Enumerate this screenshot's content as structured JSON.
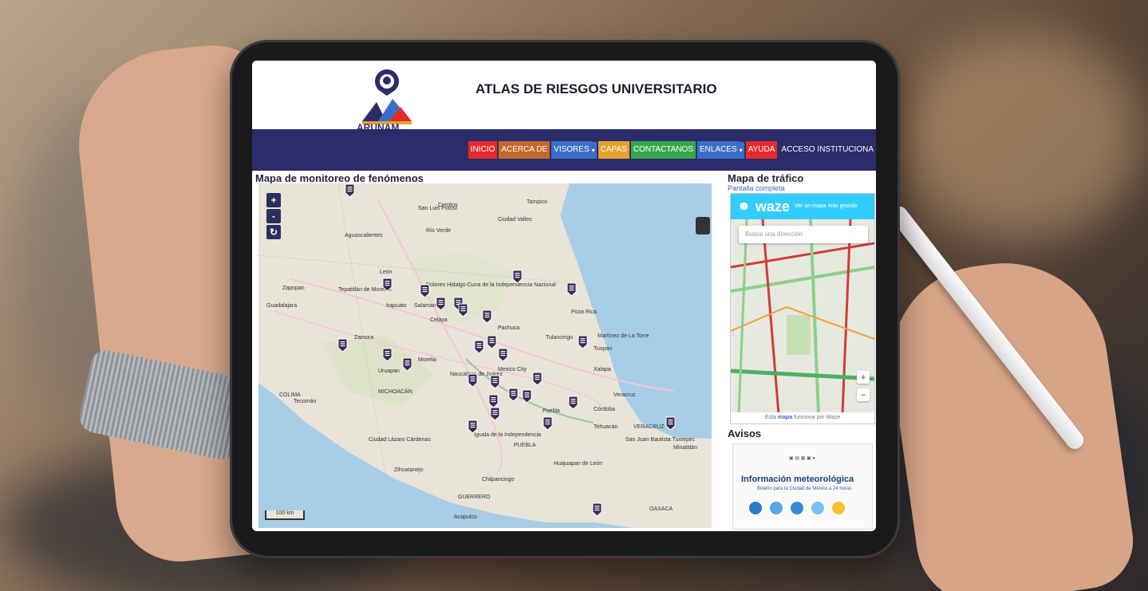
{
  "header": {
    "logo_text": "ARUNAM",
    "title": "ATLAS DE RIESGOS UNIVERSITARIO"
  },
  "nav": {
    "items": [
      {
        "label": "INICIO",
        "color": "#e52b2b"
      },
      {
        "label": "ACERCA DE",
        "color": "#c4692c"
      },
      {
        "label": "VISORES",
        "color": "#3a6fc9",
        "dropdown": true
      },
      {
        "label": "CAPAS",
        "color": "#e5a12b"
      },
      {
        "label": "CONTACTANOS",
        "color": "#36a94b"
      },
      {
        "label": "ENLACES",
        "color": "#3a6fc9",
        "dropdown": true
      },
      {
        "label": "AYUDA",
        "color": "#e52b2b"
      },
      {
        "label": "ACCESO INSTITUCIONA",
        "color": "#2a2c6b"
      }
    ]
  },
  "map_panel": {
    "title": "Mapa de monitoreo de fenómenos",
    "zoom_in": "+",
    "zoom_out": "-",
    "reset": "↻",
    "scale": "100 km",
    "places": [
      {
        "label": "San Luis Potosí"
      },
      {
        "label": "Ciudad Valles"
      },
      {
        "label": "Aguascalientes"
      },
      {
        "label": "Tampico"
      },
      {
        "label": "Zapopan"
      },
      {
        "label": "Guadalajara"
      },
      {
        "label": "León"
      },
      {
        "label": "Tepatitlán de Morelos"
      },
      {
        "label": "Irapuato"
      },
      {
        "label": "Salamanca"
      },
      {
        "label": "Celaya"
      },
      {
        "label": "Poza Rica"
      },
      {
        "label": "Morelia"
      },
      {
        "label": "Mexico City"
      },
      {
        "label": "Puebla"
      },
      {
        "label": "Córdoba"
      },
      {
        "label": "Veracruz"
      },
      {
        "label": "Xalapa"
      },
      {
        "label": "Tehuacán"
      },
      {
        "label": "Chilpancingo"
      },
      {
        "label": "Acapulco"
      },
      {
        "label": "Iguala de la Independencia"
      },
      {
        "label": "Zihuatanejo"
      },
      {
        "label": "Ciudad Lázaro Cárdenas"
      },
      {
        "label": "Tecomán"
      },
      {
        "label": "COLIMA"
      },
      {
        "label": "MICHOACÁN"
      },
      {
        "label": "GUERRERO"
      },
      {
        "label": "OAXACA"
      },
      {
        "label": "VERACRUZ"
      },
      {
        "label": "PUEBLA"
      },
      {
        "label": "Huajuapan de León"
      },
      {
        "label": "Minatitlán"
      },
      {
        "label": "San Juan Bautista Tuxtepec"
      },
      {
        "label": "Uruapan"
      },
      {
        "label": "Zamora"
      },
      {
        "label": "Dolores Hidalgo Cuna de la Independencia Nacional"
      },
      {
        "label": "Naucalpan de Juárez"
      },
      {
        "label": "Tulancingo"
      },
      {
        "label": "Pachuca"
      },
      {
        "label": "Martínez de La Torre"
      },
      {
        "label": "Tuxpan"
      },
      {
        "label": "Río Verde"
      },
      {
        "label": "Cerritos"
      }
    ]
  },
  "traffic_panel": {
    "title": "Mapa de tráfico",
    "fullscreen_link": "Pantalla completa",
    "waze_logo": "waze",
    "waze_bigger": "Ver un mapa más grande",
    "search_placeholder": "Busca una dirección",
    "footer_prefix": "Esta",
    "footer_link": "mapa",
    "footer_suffix": "funciona por Waze",
    "zoom_in": "+",
    "zoom_out": "−"
  },
  "avisos": {
    "title": "Avisos",
    "heading": "Información meteorológica",
    "subheading": "Boletín para la Ciudad de México a 24 horas"
  }
}
